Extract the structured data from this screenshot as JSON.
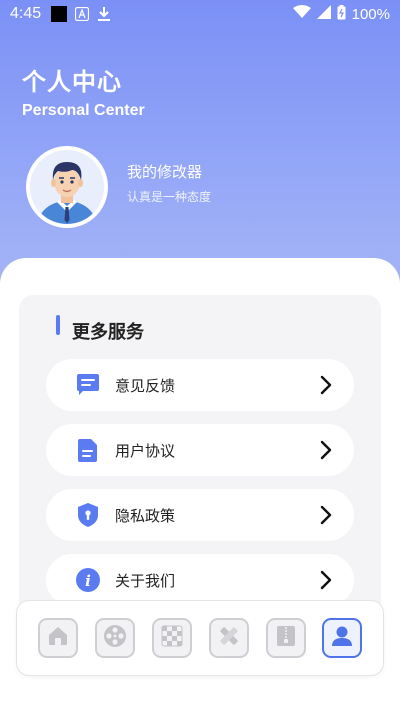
{
  "status_bar": {
    "time": "4:45",
    "battery": "100%"
  },
  "header": {
    "title_cn": "个人中心",
    "title_en": "Personal Center"
  },
  "profile": {
    "name": "我的修改器",
    "motto": "认真是一种态度"
  },
  "services": {
    "title": "更多服务",
    "items": [
      {
        "label": "意见反馈",
        "icon": "feedback-icon"
      },
      {
        "label": "用户协议",
        "icon": "document-icon"
      },
      {
        "label": "隐私政策",
        "icon": "shield-icon"
      },
      {
        "label": "关于我们",
        "icon": "info-icon"
      }
    ]
  },
  "tabbar": {
    "tabs": [
      {
        "icon": "home-icon",
        "active": false
      },
      {
        "icon": "film-reel-icon",
        "active": false
      },
      {
        "icon": "checkerboard-icon",
        "active": false
      },
      {
        "icon": "pencil-ruler-icon",
        "active": false
      },
      {
        "icon": "archive-icon",
        "active": false
      },
      {
        "icon": "profile-icon",
        "active": true
      }
    ]
  },
  "colors": {
    "accent": "#5a7cf0",
    "header_gradient_top": "#7b90f6",
    "header_gradient_bottom": "#a8b6f6"
  }
}
